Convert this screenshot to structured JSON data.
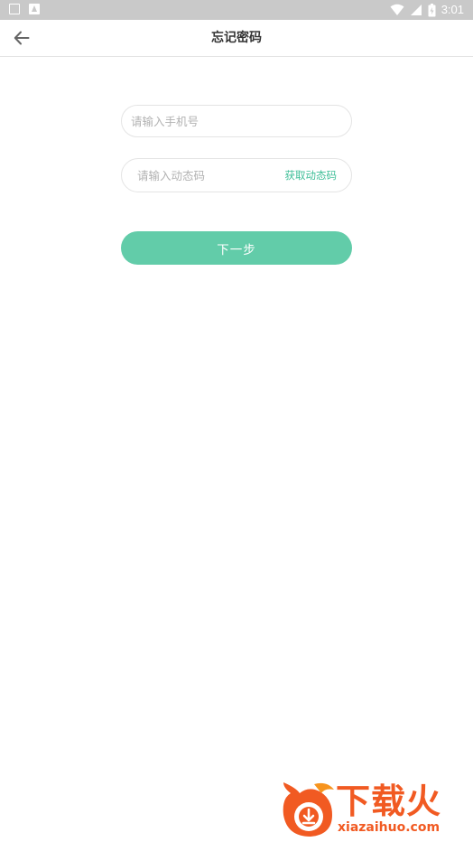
{
  "status_bar": {
    "time": "3:01",
    "icons": [
      "notification-box-icon",
      "app-a-icon",
      "wifi-icon",
      "signal-icon",
      "battery-icon"
    ]
  },
  "header": {
    "title": "忘记密码",
    "back_icon": "arrow-left-icon"
  },
  "form": {
    "phone": {
      "placeholder": "请输入手机号",
      "value": ""
    },
    "code": {
      "placeholder": "请输入动态码",
      "value": "",
      "get_code_label": "获取动态码"
    },
    "next_label": "下一步"
  },
  "watermark": {
    "title": "下载火",
    "domain": "xiazaihuo.com"
  },
  "colors": {
    "accent": "#62cca9",
    "link": "#3fbf98",
    "status_bar": "#c9c9c9",
    "watermark": "#f15a22"
  }
}
